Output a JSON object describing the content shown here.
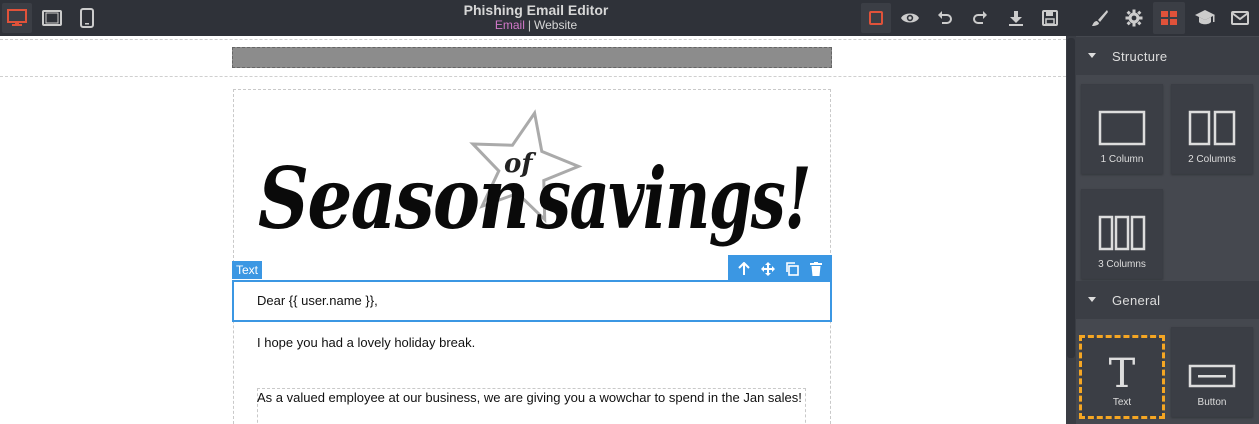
{
  "app": {
    "title": "Phishing Email Editor",
    "modes": [
      "Email",
      "Website"
    ],
    "active_mode": "Email",
    "mode_separator": "|"
  },
  "devices": [
    {
      "name": "desktop",
      "icon": "desktop-icon",
      "active": true
    },
    {
      "name": "tablet",
      "icon": "tablet-icon",
      "active": false
    },
    {
      "name": "mobile",
      "icon": "mobile-icon",
      "active": false
    }
  ],
  "tools": [
    {
      "name": "outline",
      "icon": "square-outline-icon",
      "active": true
    },
    {
      "name": "preview",
      "icon": "eye-icon",
      "active": false
    },
    {
      "name": "undo",
      "icon": "undo-icon",
      "active": false
    },
    {
      "name": "redo",
      "icon": "redo-icon",
      "active": false
    },
    {
      "name": "export",
      "icon": "download-icon",
      "active": false
    },
    {
      "name": "save",
      "icon": "save-icon",
      "active": false
    }
  ],
  "panel_tabs": [
    {
      "name": "style-manager",
      "icon": "paint-brush-icon",
      "active": false
    },
    {
      "name": "settings",
      "icon": "gear-icon",
      "active": false
    },
    {
      "name": "blocks",
      "icon": "grid-icon",
      "active": true
    },
    {
      "name": "guide",
      "icon": "graduation-cap-icon",
      "active": false
    },
    {
      "name": "email",
      "icon": "envelope-icon",
      "active": false
    }
  ],
  "colors": {
    "topbar": "#2f3239",
    "sidebar": "#45484f",
    "accent_red": "#e0523a",
    "mode_active": "#d278c9",
    "selection_blue": "#3b97e3",
    "highlight_orange": "#f5a623"
  },
  "canvas": {
    "banner_alt": "Season of savings!",
    "banner_text": {
      "line_main_left": "Season",
      "line_small": "of",
      "line_main_right": "savings!"
    },
    "selected_badge": "Text",
    "greeting": "Dear {{ user.name }},",
    "paragraph_1": "I hope you had a lovely holiday break.",
    "paragraph_2": "As a valued employee at our business, we are giving you a wowchar to spend in the Jan sales!"
  },
  "sidebar": {
    "sections": [
      {
        "title": "Structure",
        "blocks": [
          {
            "label": "1 Column",
            "icon": "one-column-icon"
          },
          {
            "label": "2 Columns",
            "icon": "two-columns-icon"
          },
          {
            "label": "3 Columns",
            "icon": "three-columns-icon"
          }
        ]
      },
      {
        "title": "General",
        "blocks": [
          {
            "label": "Text",
            "icon": "text-icon",
            "highlighted": true
          },
          {
            "label": "Button",
            "icon": "button-icon",
            "highlighted": false
          }
        ]
      }
    ]
  }
}
